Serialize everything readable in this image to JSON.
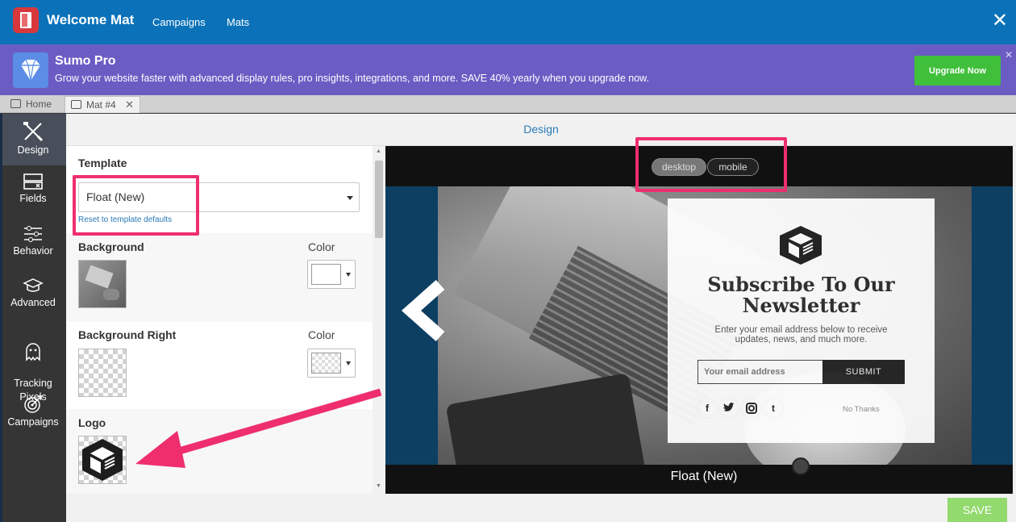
{
  "app": {
    "title": "Welcome Mat",
    "nav": [
      "Campaigns",
      "Mats"
    ]
  },
  "promo": {
    "title": "Sumo Pro",
    "text": "Grow your website faster with advanced display rules, pro insights, integrations, and more. SAVE 40% yearly when you upgrade now.",
    "button": "Upgrade Now"
  },
  "tabs": [
    {
      "label": "Home"
    },
    {
      "label": "Mat #4"
    }
  ],
  "sidebar": {
    "items": [
      {
        "label": "Design"
      },
      {
        "label": "Fields"
      },
      {
        "label": "Behavior"
      },
      {
        "label": "Advanced"
      },
      {
        "label": "Tracking\nPixels"
      },
      {
        "label": "Campaigns"
      }
    ]
  },
  "section_title": "Design",
  "settings": {
    "template_label": "Template",
    "template_value": "Float (New)",
    "reset_link": "Reset to template defaults",
    "background_label": "Background",
    "background_right_label": "Background Right",
    "logo_label": "Logo",
    "color_label": "Color"
  },
  "preview": {
    "desktop": "desktop",
    "mobile": "mobile",
    "title": "Subscribe To Our Newsletter",
    "subtitle": "Enter your email address below to receive updates, news, and much more.",
    "email_placeholder": "Your email address",
    "submit": "SUBMIT",
    "no_thanks": "No Thanks",
    "social": [
      "f",
      "t",
      "i",
      "t"
    ],
    "caption": "Float (New)"
  },
  "footer": {
    "save": "SAVE"
  },
  "colors": {
    "topbar": "#0b72b9",
    "promo": "#6b5cc4",
    "upgrade": "#3fbf3a",
    "annotation": "#ef2e6e",
    "save": "#92d96e"
  }
}
